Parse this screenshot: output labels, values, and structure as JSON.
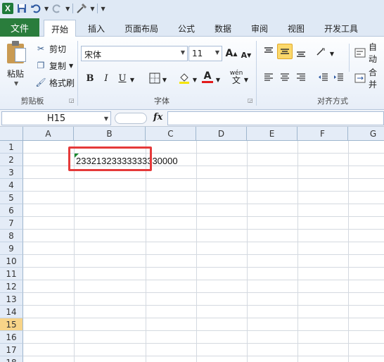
{
  "qat": {
    "logo": "X",
    "icons": [
      "save-icon",
      "undo-icon",
      "redo-icon",
      "customize-icon"
    ]
  },
  "tabs": {
    "file": "文件",
    "items": [
      "开始",
      "插入",
      "页面布局",
      "公式",
      "数据",
      "审阅",
      "视图",
      "开发工具"
    ],
    "active": "开始"
  },
  "ribbon": {
    "clipboard": {
      "paste": "粘贴",
      "cut": "剪切",
      "copy": "复制",
      "format_painter": "格式刷",
      "group_label": "剪贴板"
    },
    "font": {
      "font_name": "宋体",
      "font_size": "11",
      "bold": "B",
      "italic": "I",
      "underline": "U",
      "grow": "A",
      "shrink": "A",
      "wen": "wén",
      "group_label": "字体"
    },
    "alignment": {
      "wrap": "自动",
      "merge": "合并",
      "group_label": "对齐方式"
    }
  },
  "formula_bar": {
    "name_box": "H15",
    "fx": "fx",
    "value": ""
  },
  "grid": {
    "columns": [
      "A",
      "B",
      "C",
      "D",
      "E",
      "F",
      "G"
    ],
    "rows": [
      "1",
      "2",
      "3",
      "4",
      "5",
      "6",
      "7",
      "8",
      "9",
      "10",
      "11",
      "12",
      "13",
      "14",
      "15",
      "16",
      "17",
      "18"
    ],
    "active_row": "15",
    "b2": "23321323333333330000"
  },
  "colors": {
    "file_tab": "#2a7d3c",
    "highlight_box": "#e53a3a",
    "active_row": "#f8d488"
  }
}
